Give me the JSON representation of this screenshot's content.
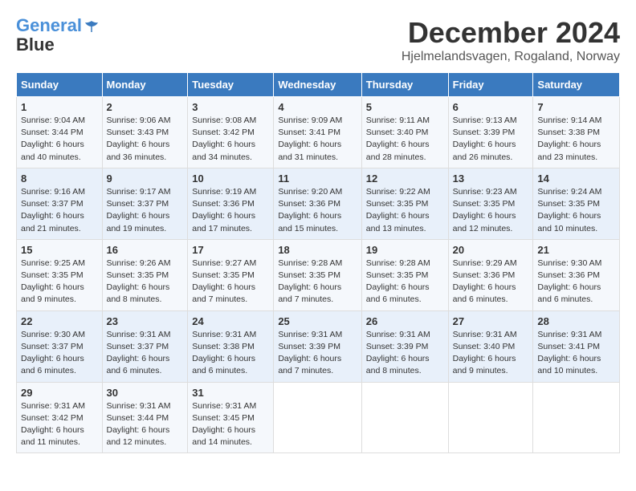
{
  "logo": {
    "line1": "General",
    "line2": "Blue"
  },
  "title": "December 2024",
  "location": "Hjelmelandsvagen, Rogaland, Norway",
  "days_of_week": [
    "Sunday",
    "Monday",
    "Tuesday",
    "Wednesday",
    "Thursday",
    "Friday",
    "Saturday"
  ],
  "weeks": [
    [
      {
        "day": "1",
        "sunrise": "9:04 AM",
        "sunset": "3:44 PM",
        "daylight": "6 hours and 40 minutes."
      },
      {
        "day": "2",
        "sunrise": "9:06 AM",
        "sunset": "3:43 PM",
        "daylight": "6 hours and 36 minutes."
      },
      {
        "day": "3",
        "sunrise": "9:08 AM",
        "sunset": "3:42 PM",
        "daylight": "6 hours and 34 minutes."
      },
      {
        "day": "4",
        "sunrise": "9:09 AM",
        "sunset": "3:41 PM",
        "daylight": "6 hours and 31 minutes."
      },
      {
        "day": "5",
        "sunrise": "9:11 AM",
        "sunset": "3:40 PM",
        "daylight": "6 hours and 28 minutes."
      },
      {
        "day": "6",
        "sunrise": "9:13 AM",
        "sunset": "3:39 PM",
        "daylight": "6 hours and 26 minutes."
      },
      {
        "day": "7",
        "sunrise": "9:14 AM",
        "sunset": "3:38 PM",
        "daylight": "6 hours and 23 minutes."
      }
    ],
    [
      {
        "day": "8",
        "sunrise": "9:16 AM",
        "sunset": "3:37 PM",
        "daylight": "6 hours and 21 minutes."
      },
      {
        "day": "9",
        "sunrise": "9:17 AM",
        "sunset": "3:37 PM",
        "daylight": "6 hours and 19 minutes."
      },
      {
        "day": "10",
        "sunrise": "9:19 AM",
        "sunset": "3:36 PM",
        "daylight": "6 hours and 17 minutes."
      },
      {
        "day": "11",
        "sunrise": "9:20 AM",
        "sunset": "3:36 PM",
        "daylight": "6 hours and 15 minutes."
      },
      {
        "day": "12",
        "sunrise": "9:22 AM",
        "sunset": "3:35 PM",
        "daylight": "6 hours and 13 minutes."
      },
      {
        "day": "13",
        "sunrise": "9:23 AM",
        "sunset": "3:35 PM",
        "daylight": "6 hours and 12 minutes."
      },
      {
        "day": "14",
        "sunrise": "9:24 AM",
        "sunset": "3:35 PM",
        "daylight": "6 hours and 10 minutes."
      }
    ],
    [
      {
        "day": "15",
        "sunrise": "9:25 AM",
        "sunset": "3:35 PM",
        "daylight": "6 hours and 9 minutes."
      },
      {
        "day": "16",
        "sunrise": "9:26 AM",
        "sunset": "3:35 PM",
        "daylight": "6 hours and 8 minutes."
      },
      {
        "day": "17",
        "sunrise": "9:27 AM",
        "sunset": "3:35 PM",
        "daylight": "6 hours and 7 minutes."
      },
      {
        "day": "18",
        "sunrise": "9:28 AM",
        "sunset": "3:35 PM",
        "daylight": "6 hours and 7 minutes."
      },
      {
        "day": "19",
        "sunrise": "9:28 AM",
        "sunset": "3:35 PM",
        "daylight": "6 hours and 6 minutes."
      },
      {
        "day": "20",
        "sunrise": "9:29 AM",
        "sunset": "3:36 PM",
        "daylight": "6 hours and 6 minutes."
      },
      {
        "day": "21",
        "sunrise": "9:30 AM",
        "sunset": "3:36 PM",
        "daylight": "6 hours and 6 minutes."
      }
    ],
    [
      {
        "day": "22",
        "sunrise": "9:30 AM",
        "sunset": "3:37 PM",
        "daylight": "6 hours and 6 minutes."
      },
      {
        "day": "23",
        "sunrise": "9:31 AM",
        "sunset": "3:37 PM",
        "daylight": "6 hours and 6 minutes."
      },
      {
        "day": "24",
        "sunrise": "9:31 AM",
        "sunset": "3:38 PM",
        "daylight": "6 hours and 6 minutes."
      },
      {
        "day": "25",
        "sunrise": "9:31 AM",
        "sunset": "3:39 PM",
        "daylight": "6 hours and 7 minutes."
      },
      {
        "day": "26",
        "sunrise": "9:31 AM",
        "sunset": "3:39 PM",
        "daylight": "6 hours and 8 minutes."
      },
      {
        "day": "27",
        "sunrise": "9:31 AM",
        "sunset": "3:40 PM",
        "daylight": "6 hours and 9 minutes."
      },
      {
        "day": "28",
        "sunrise": "9:31 AM",
        "sunset": "3:41 PM",
        "daylight": "6 hours and 10 minutes."
      }
    ],
    [
      {
        "day": "29",
        "sunrise": "9:31 AM",
        "sunset": "3:42 PM",
        "daylight": "6 hours and 11 minutes."
      },
      {
        "day": "30",
        "sunrise": "9:31 AM",
        "sunset": "3:44 PM",
        "daylight": "6 hours and 12 minutes."
      },
      {
        "day": "31",
        "sunrise": "9:31 AM",
        "sunset": "3:45 PM",
        "daylight": "6 hours and 14 minutes."
      },
      null,
      null,
      null,
      null
    ]
  ]
}
